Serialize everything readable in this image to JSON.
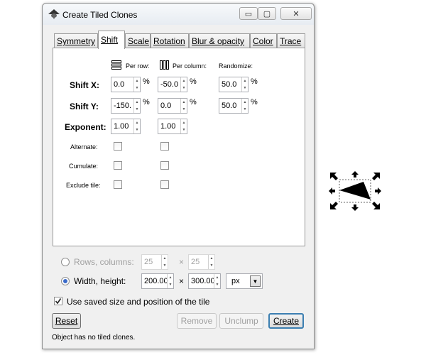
{
  "window": {
    "title": "Create Tiled Clones",
    "minimize_glyph": "▭",
    "maximize_glyph": "▢",
    "close_glyph": "✕"
  },
  "tabs": [
    {
      "label": "Symmetry"
    },
    {
      "label": "Shift"
    },
    {
      "label": "Scale"
    },
    {
      "label": "Rotation"
    },
    {
      "label": "Blur & opacity"
    },
    {
      "label": "Color"
    },
    {
      "label": "Trace"
    }
  ],
  "active_tab": "Shift",
  "shift": {
    "col_per_row": "Per row:",
    "col_per_column": "Per column:",
    "col_randomize": "Randomize:",
    "shift_x_label": "Shift X:",
    "shift_y_label": "Shift Y:",
    "exponent_label": "Exponent:",
    "alternate_label": "Alternate:",
    "cumulate_label": "Cumulate:",
    "exclude_label": "Exclude tile:",
    "shift_x": {
      "per_row": "0.0",
      "per_column": "-50.0",
      "randomize": "50.0"
    },
    "shift_y": {
      "per_row": "-150.",
      "per_column": "0.0",
      "randomize": "50.0"
    },
    "exponent": {
      "per_row": "1.00",
      "per_column": "1.00"
    },
    "percent": "%"
  },
  "size": {
    "rows_columns_label": "Rows, columns:",
    "rows": "25",
    "columns": "25",
    "width_height_label": "Width, height:",
    "width": "200.00",
    "height": "300.00",
    "unit": "px",
    "times": "×",
    "selected_mode": "width-height"
  },
  "use_saved_label": "Use saved size and position of the tile",
  "use_saved_checked": true,
  "buttons": {
    "reset": "Reset",
    "remove": "Remove",
    "unclump": "Unclump",
    "create": "Create"
  },
  "status": "Object has no tiled clones.",
  "colors": {
    "accent": "#3a6ac9",
    "window_bg": "#f0f0f0"
  }
}
